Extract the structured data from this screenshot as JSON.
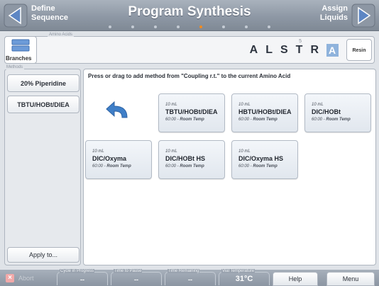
{
  "header": {
    "back_label_line1": "Define",
    "back_label_line2": "Sequence",
    "title": "Program Synthesis",
    "forward_label_line1": "Assign",
    "forward_label_line2": "Liquids",
    "progress_dots": 8,
    "active_dot_index": 4
  },
  "amino_acids": {
    "legend": "Amino Acids",
    "branches_label": "Branches",
    "sequence": [
      "A",
      "L",
      "S",
      "T",
      "R",
      "A"
    ],
    "selected_index": 5,
    "counter": "5",
    "resin_label": "Resin"
  },
  "methods": {
    "legend": "Methods",
    "items": [
      {
        "label": "20% Piperidine"
      },
      {
        "label": "TBTU/HOBt/DIEA"
      }
    ],
    "apply_label": "Apply to..."
  },
  "main": {
    "instruction": "Press or drag to add method from \"Coupling r.t.\" to the current Amino Acid",
    "cards": [
      {
        "volume": "10 mL",
        "name": "TBTU/HOBt/DIEA",
        "time": "60:00",
        "temp": "Room Temp"
      },
      {
        "volume": "10 mL",
        "name": "HBTU/HOBt/DIEA",
        "time": "60:00",
        "temp": "Room Temp"
      },
      {
        "volume": "10 mL",
        "name": "DIC/HOBt",
        "time": "60:00",
        "temp": "Room Temp"
      },
      {
        "volume": "10 mL",
        "name": "DIC/Oxyma",
        "time": "60:00",
        "temp": "Room Temp"
      },
      {
        "volume": "10 mL",
        "name": "DIC/HOBt HS",
        "time": "60:00",
        "temp": "Room Temp"
      },
      {
        "volume": "10 mL",
        "name": "DIC/Oxyma HS",
        "time": "60:00",
        "temp": "Room Temp"
      }
    ]
  },
  "footer": {
    "abort_label": "Abort",
    "cycle_label": "Cycle in Progress",
    "cycle_value": "--",
    "pause_label": "Time to Pause",
    "pause_value": "--",
    "remaining_label": "Time Remaining",
    "remaining_value": "--",
    "temp_label": "Vial Temperature",
    "temp_value": "31°C",
    "help_label": "Help",
    "menu_label": "Menu"
  },
  "colors": {
    "accent_dot": "#f28a1e",
    "selected_amino_acid": "#8fb3dc",
    "nav_arrow": "#5d86c4",
    "undo_arrow": "#3f7fc8"
  }
}
